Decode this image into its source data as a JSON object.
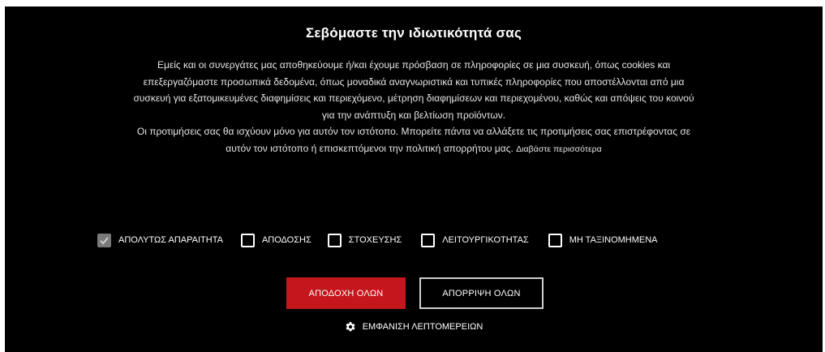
{
  "banner": {
    "title": "Σεβόμαστε την ιδιωτικότητά σας",
    "paragraph1": "Εμείς και οι συνεργάτες μας αποθηκεύουμε ή/και έχουμε πρόσβαση σε πληροφορίες σε μια συσκευή, όπως cookies και επεξεργαζόμαστε προσωπικά δεδομένα, όπως μοναδικά αναγνωριστικά και τυπικές πληροφορίες που αποστέλλονται από μια συσκευή για εξατομικευμένες διαφημίσεις και περιεχόμενο, μέτρηση διαφημίσεων και περιεχομένου, καθώς και απόψεις του κοινού για την ανάπτυξη και βελτίωση προϊόντων.",
    "paragraph2": "Οι προτιμήσεις σας θα ισχύουν μόνο για αυτόν τον ιστότοπο. Μπορείτε πάντα να αλλάξετε τις προτιμήσεις σας επιστρέφοντας σε αυτόν τον ιστότοπο ή επισκεπτόμενοι την πολιτική απορρήτου μας.",
    "read_more_label": "Διαβάστε περισσότερα"
  },
  "categories": [
    {
      "label": "ΑΠΟΛΥΤΩΣ ΑΠΑΡΑΙΤΗΤΑ",
      "checked": true
    },
    {
      "label": "ΑΠΟΔΟΣΗΣ",
      "checked": false
    },
    {
      "label": "ΣΤΟΧΕΥΣΗΣ",
      "checked": false
    },
    {
      "label": "ΛΕΙΤΟΥΡΓΙΚΟΤΗΤΑΣ",
      "checked": false
    },
    {
      "label": "ΜΗ ΤΑΞΙΝΟΜΗΜΕΝΑ",
      "checked": false
    }
  ],
  "buttons": {
    "accept_all": "ΑΠΟΔΟΧΗ ΟΛΩΝ",
    "reject_all": "ΑΠΟΡΡΙΨΗ ΟΛΩΝ"
  },
  "details": {
    "label": "ΕΜΦΑΝΙΣΗ ΛΕΠΤΟΜΕΡΕΙΩΝ",
    "icon": "gear-icon"
  },
  "colors": {
    "background": "#000000",
    "accept_button": "#c4161c",
    "checked_box": "#7a7a7a"
  }
}
